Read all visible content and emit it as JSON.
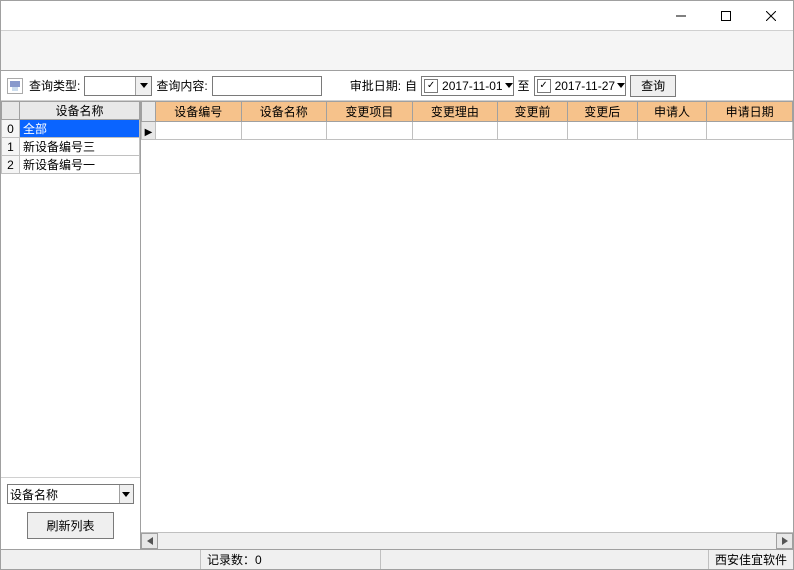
{
  "filter": {
    "query_type_label": "查询类型:",
    "query_type_value": "",
    "query_content_label": "查询内容:",
    "query_content_value": "",
    "audit_date_label": "审批日期:",
    "from_label": "自",
    "date_from": "2017-11-01",
    "to_label": "至",
    "date_to": "2017-11-27",
    "search_btn": "查询"
  },
  "sidebar": {
    "header": "设备名称",
    "rows": [
      {
        "idx": "0",
        "name": "全部",
        "selected": true
      },
      {
        "idx": "1",
        "name": "新设备编号三",
        "selected": false
      },
      {
        "idx": "2",
        "name": "新设备编号一",
        "selected": false
      }
    ],
    "bottom_combo": "设备名称",
    "refresh_btn": "刷新列表"
  },
  "grid": {
    "columns": [
      "设备编号",
      "设备名称",
      "变更项目",
      "变更理由",
      "变更前",
      "变更后",
      "申请人",
      "申请日期"
    ]
  },
  "status": {
    "record_count_label": "记录数：",
    "record_count": "0",
    "vendor": "西安佳宜软件"
  }
}
